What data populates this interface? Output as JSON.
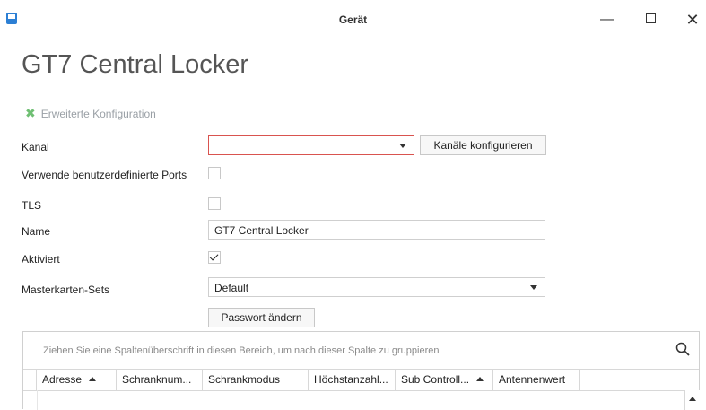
{
  "window": {
    "title": "Gerät"
  },
  "page": {
    "title": "GT7 Central Locker"
  },
  "advanced": {
    "label": "Erweiterte Konfiguration"
  },
  "form": {
    "kanal_label": "Kanal",
    "kanal_value": "",
    "kanal_button": "Kanäle konfigurieren",
    "ports_label": "Verwende benutzerdefinierte Ports",
    "ports_checked": false,
    "tls_label": "TLS",
    "tls_checked": false,
    "name_label": "Name",
    "name_value": "GT7 Central Locker",
    "active_label": "Aktiviert",
    "active_checked": true,
    "master_label": "Masterkarten-Sets",
    "master_value": "Default",
    "password_button": "Passwort ändern"
  },
  "grid": {
    "group_hint": "Ziehen Sie eine Spaltenüberschrift in diesen Bereich, um nach dieser Spalte zu gruppieren",
    "columns": [
      "Adresse",
      "Schranknum...",
      "Schrankmodus",
      "Höchstanzahl...",
      "Sub Controll...",
      "Antennenwert"
    ]
  },
  "colors": {
    "accent": "#2c7fd4",
    "error_border": "#d9534f",
    "tool_icon": "#6fbf73"
  }
}
